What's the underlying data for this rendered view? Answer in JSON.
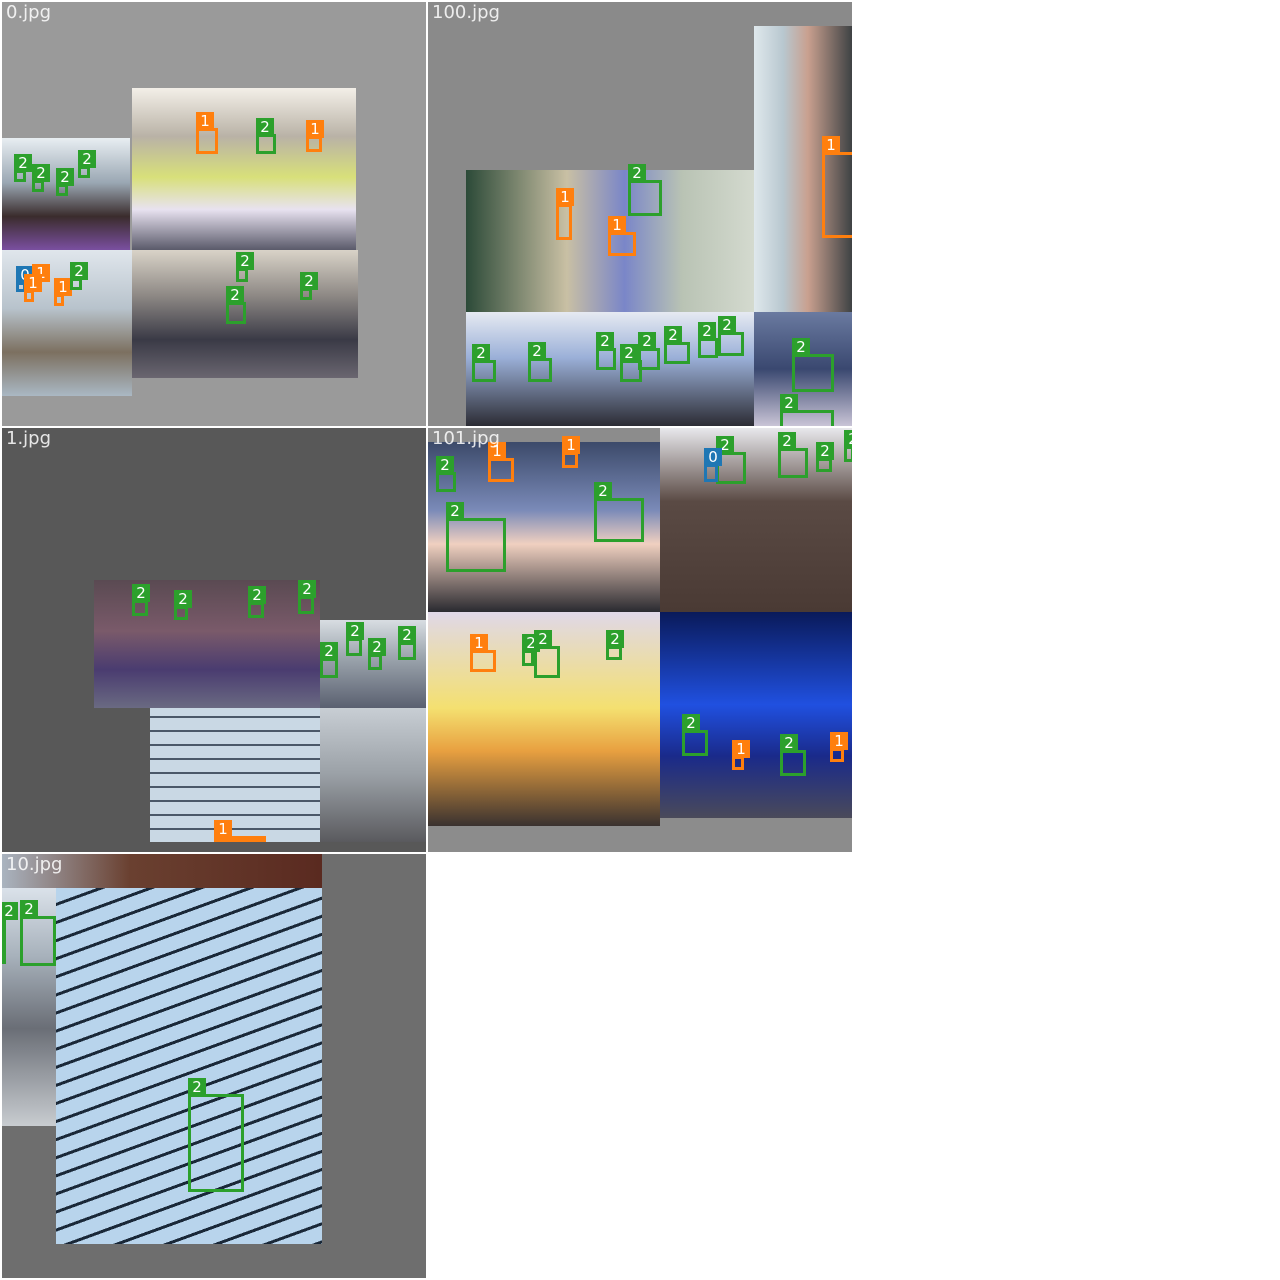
{
  "tiles": [
    {
      "label": "0.jpg",
      "bg": "#9a9a9a"
    },
    {
      "label": "100.jpg",
      "bg": "#8a8a8a"
    },
    {
      "label": "1.jpg",
      "bg": "#585858"
    },
    {
      "label": "101.jpg",
      "bg": "#8c8c8c"
    },
    {
      "label": "10.jpg",
      "bg": "#6e6e6e"
    }
  ],
  "classes": {
    "c0": "0",
    "c1": "1",
    "c2": "2"
  },
  "class_colors": {
    "c0": "#1f77b4",
    "c1": "#ff7f0e",
    "c2": "#2ca02c"
  }
}
